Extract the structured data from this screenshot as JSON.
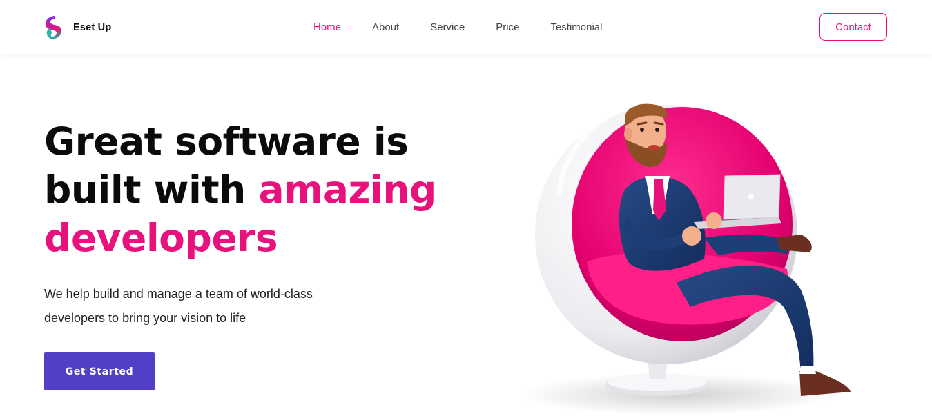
{
  "brand": {
    "name": "Eset Up"
  },
  "nav": {
    "items": [
      {
        "label": "Home",
        "active": true
      },
      {
        "label": "About"
      },
      {
        "label": "Service"
      },
      {
        "label": "Price"
      },
      {
        "label": "Testimonial"
      }
    ]
  },
  "header": {
    "contact_label": "Contact"
  },
  "hero": {
    "title_line1": "Great software is",
    "title_line2_plain": "built with ",
    "title_line2_accent": "amazing",
    "title_line3_accent": "developers",
    "subtitle": "We help build and manage a team of world-class developers to bring your vision to life",
    "cta_label": "Get Started"
  },
  "colors": {
    "accent": "#e8127c",
    "primary_button": "#5140c6",
    "text": "#0b0b0b"
  },
  "illustration": {
    "icon": "man-in-egg-chair-with-laptop-illustration"
  }
}
